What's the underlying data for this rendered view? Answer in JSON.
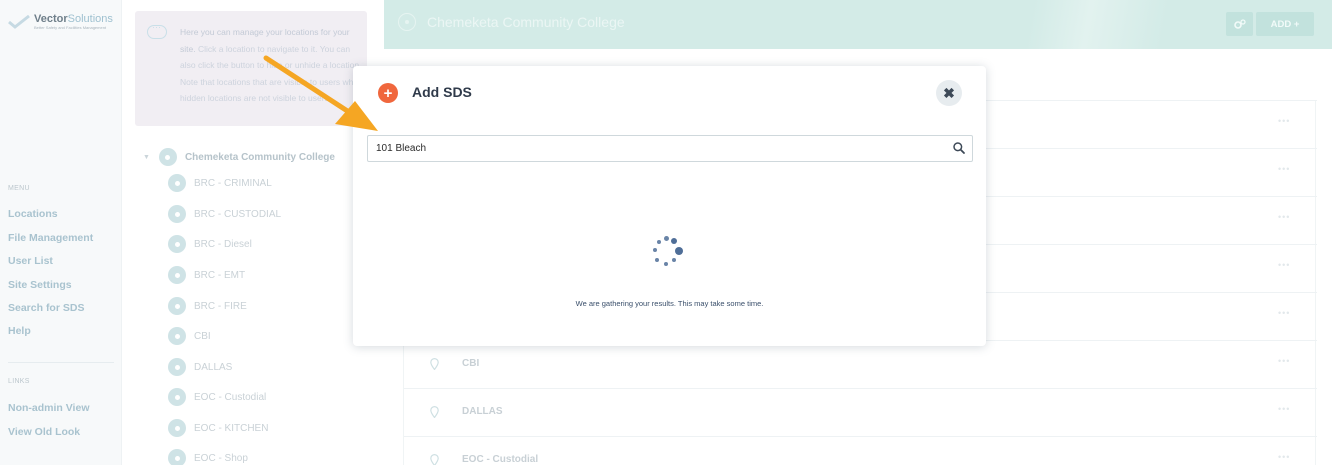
{
  "brand": {
    "name_part1": "Vector",
    "name_part2": "Solutions",
    "tagline": "Better Safety and Facilities Management"
  },
  "nav": {
    "menu_header": "MENU",
    "menu_items": [
      "Locations",
      "File Management",
      "User List",
      "Site Settings",
      "Search for SDS",
      "Help"
    ],
    "links_header": "LINKS",
    "link_items": [
      "Non-admin View",
      "View Old Look"
    ]
  },
  "info": {
    "lead": "Here you can manage your locations for your site.",
    "body": "Click a location to navigate to it. You can also click the button to hide or unhide a location. Note that locations that are visible to users while hidden locations are not visible to users."
  },
  "tree": {
    "root": "Chemeketa Community College",
    "items": [
      "BRC - CRIMINAL",
      "BRC - CUSTODIAL",
      "BRC - Diesel",
      "BRC - EMT",
      "BRC - FIRE",
      "CBI",
      "DALLAS",
      "EOC - Custodial",
      "EOC - KITCHEN",
      "EOC - Shop"
    ]
  },
  "header": {
    "title": "Chemeketa Community College",
    "add_label": "ADD +"
  },
  "list": {
    "rows": [
      "",
      "",
      "",
      "",
      "",
      "CBI",
      "DALLAS",
      "EOC - Custodial"
    ],
    "dots": "•••"
  },
  "modal": {
    "title": "Add SDS",
    "search_value": "101 Bleach",
    "loading_text": "We are gathering your results. This may take some time."
  },
  "colors": {
    "accent_orange": "#f0673d",
    "arrow": "#f5a623",
    "spinner": "#4f6e98",
    "header_teal": "#d3ebe7"
  }
}
